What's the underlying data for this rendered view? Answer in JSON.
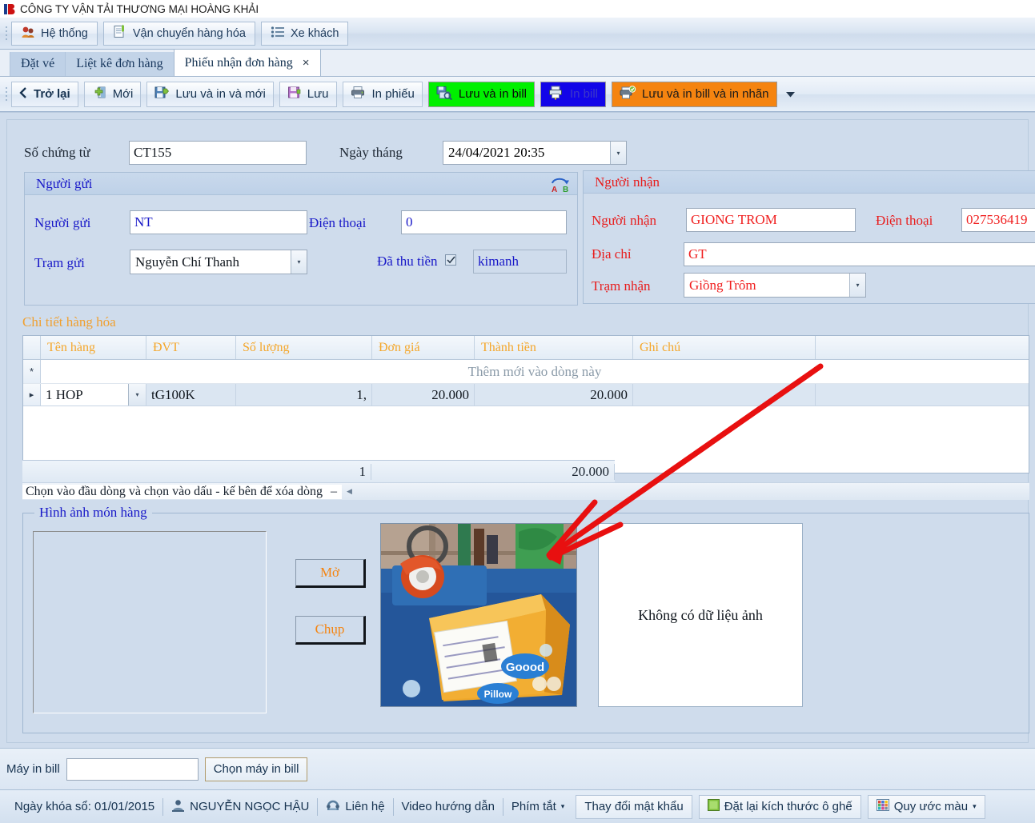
{
  "window": {
    "title": "CÔNG TY VẬN TẢI THƯƠNG MẠI HOÀNG KHẢI"
  },
  "menu": {
    "items": [
      {
        "label": "Hệ thống",
        "icon": "users-icon"
      },
      {
        "label": "Vận chuyển hàng hóa",
        "icon": "document-new-icon"
      },
      {
        "label": "Xe khách",
        "icon": "list-icon"
      }
    ]
  },
  "tabs": [
    {
      "label": "Đặt vé",
      "active": false
    },
    {
      "label": "Liệt kê đơn hàng",
      "active": false
    },
    {
      "label": "Phiếu nhận đơn hàng",
      "active": true,
      "close": "×"
    }
  ],
  "toolbar": {
    "buttons": [
      {
        "label": "Trở lại",
        "icon": "back-chevron-icon",
        "accent": ""
      },
      {
        "label": "Mới",
        "icon": "new-icon",
        "accent": ""
      },
      {
        "label": "Lưu và in và mới",
        "icon": "save-print-new-icon",
        "accent": ""
      },
      {
        "label": "Lưu",
        "icon": "save-icon",
        "accent": ""
      },
      {
        "label": "In phiếu",
        "icon": "printer-icon",
        "accent": ""
      },
      {
        "label": "Lưu và in bill",
        "icon": "save-bill-icon",
        "accent": "green"
      },
      {
        "label": "In bill",
        "icon": "print-bill-icon",
        "accent": "blue"
      },
      {
        "label": "Lưu và in bill và in nhãn",
        "icon": "print-label-icon",
        "accent": "orange"
      }
    ],
    "overflow_icon": "chevron-down-icon"
  },
  "form": {
    "doc_no_label": "Số chứng từ",
    "doc_no_value": "CT155",
    "date_label": "Ngày tháng",
    "date_value": "24/04/2021 20:35"
  },
  "sender": {
    "group_title": "Người gửi",
    "swap_icon": "swap-a-b-icon",
    "name_label": "Người gửi",
    "name_value": "NT",
    "phone_label": "Điện thoại",
    "phone_value": "0",
    "station_label": "Trạm gửi",
    "station_value": "Nguyễn Chí Thanh",
    "paid_label": "Đã thu tiền",
    "paid_checked": true,
    "cashier_value": "kimanh"
  },
  "receiver": {
    "group_title": "Người nhận",
    "name_label": "Người nhận",
    "name_value": "GIONG TROM",
    "phone_label": "Điện thoại",
    "phone_value": "027536419",
    "address_label": "Địa chỉ",
    "address_value": "GT",
    "station_label": "Trạm nhận",
    "station_value": "Giồng Trôm"
  },
  "goods": {
    "section_title": "Chi tiết hàng hóa",
    "columns": [
      "Tên hàng",
      "ĐVT",
      "Số lượng",
      "Đơn giá",
      "Thành tiền",
      "Ghi chú",
      ""
    ],
    "new_row_hint": "Thêm mới vào dòng này",
    "new_row_marker": "*",
    "current_row_marker": "▸",
    "rows": [
      {
        "name": "1 HOP",
        "unit": "tG100K",
        "qty": "1,",
        "price": "20.000",
        "amount": "20.000",
        "note": ""
      }
    ],
    "footer": {
      "qty_total": "1",
      "amount_total": "20.000"
    },
    "scroll_hint": "Chọn vào đầu dòng và chọn vào dấu - kế bên để xóa dòng",
    "scroll_minus": "–"
  },
  "images": {
    "group_title": "Hình ảnh món hàng",
    "open_button": "Mở",
    "capture_button": "Chụp",
    "no_data_text": "Không có dữ liệu ảnh",
    "photo_alt": "package-photo"
  },
  "printer": {
    "label": "Máy in bill",
    "value": "",
    "choose_button": "Chọn máy in bill"
  },
  "status": {
    "lock_date": "Ngày khóa sổ: 01/01/2015",
    "user": "NGUYỄN NGỌC HẬU",
    "user_icon": "user-icon",
    "contact": "Liên hệ",
    "contact_icon": "phone-icon",
    "video": "Video hướng dẫn",
    "shortcuts": "Phím tắt",
    "change_password": "Thay đổi mật khẩu",
    "reset_seat_size": "Đặt lại kích thước ô ghế",
    "color_legend": "Quy ước màu",
    "caret": "▾"
  },
  "annotation": {
    "color": "#e81010",
    "name": "red-arrow-annotation"
  },
  "colors": {
    "accent_green": "#00f000",
    "accent_blue": "#1205e8",
    "accent_orange": "#f58410",
    "label_blue": "#1818c8",
    "label_red": "#e81c1c",
    "header_orange": "#f4a62a",
    "window_bg": "#cfdcec"
  }
}
